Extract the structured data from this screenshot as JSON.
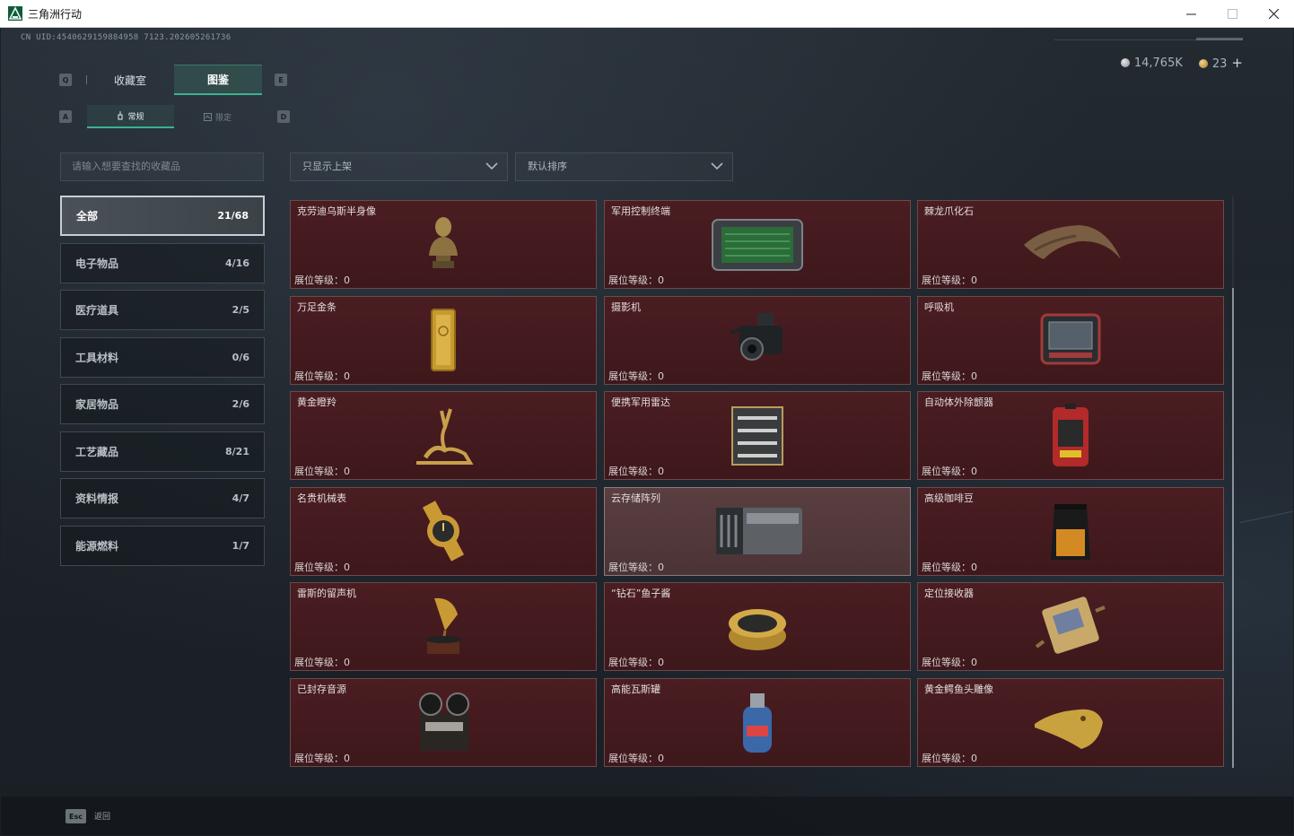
{
  "window": {
    "title": "三角洲行动"
  },
  "uid": "CN UID:4540629159884958 7123.202605261736",
  "currency": {
    "silver": "14,765K",
    "gold": "23",
    "plus": "+"
  },
  "keycaps": {
    "main_left": "Q",
    "main_right": "E",
    "sub_left": "A",
    "sub_right": "D"
  },
  "main_tabs": [
    {
      "label": "收藏室",
      "active": false
    },
    {
      "label": "图鉴",
      "active": true
    }
  ],
  "sub_tabs": [
    {
      "label": "常规",
      "active": true
    },
    {
      "label": "限定",
      "active": false
    }
  ],
  "search": {
    "placeholder": "请输入想要查找的收藏品"
  },
  "filters": {
    "shelf": "只显示上架",
    "sort": "默认排序"
  },
  "categories": [
    {
      "label": "全部",
      "count": "21/68",
      "active": true
    },
    {
      "label": "电子物品",
      "count": "4/16",
      "active": false
    },
    {
      "label": "医疗道具",
      "count": "2/5",
      "active": false
    },
    {
      "label": "工具材料",
      "count": "0/6",
      "active": false
    },
    {
      "label": "家居物品",
      "count": "2/6",
      "active": false
    },
    {
      "label": "工艺藏品",
      "count": "8/21",
      "active": false
    },
    {
      "label": "资料情报",
      "count": "4/7",
      "active": false
    },
    {
      "label": "能源燃料",
      "count": "1/7",
      "active": false
    }
  ],
  "level_label": "展位等级：",
  "items": [
    {
      "name": "克劳迪乌斯半身像",
      "level": "0",
      "icon": "bust-icon"
    },
    {
      "name": "军用控制终端",
      "level": "0",
      "icon": "terminal-icon"
    },
    {
      "name": "棘龙爪化石",
      "level": "0",
      "icon": "claw-fossil-icon"
    },
    {
      "name": "万足金条",
      "level": "0",
      "icon": "gold-bar-icon"
    },
    {
      "name": "摄影机",
      "level": "0",
      "icon": "camera-icon"
    },
    {
      "name": "呼吸机",
      "level": "0",
      "icon": "ventilator-icon"
    },
    {
      "name": "黄金瞪羚",
      "level": "0",
      "icon": "gold-gazelle-icon"
    },
    {
      "name": "便携军用雷达",
      "level": "0",
      "icon": "radar-icon"
    },
    {
      "name": "自动体外除颤器",
      "level": "0",
      "icon": "defibrillator-icon"
    },
    {
      "name": "名贵机械表",
      "level": "0",
      "icon": "watch-icon"
    },
    {
      "name": "云存储阵列",
      "level": "0",
      "icon": "storage-array-icon",
      "selected": true
    },
    {
      "name": "高级咖啡豆",
      "level": "0",
      "icon": "coffee-bag-icon"
    },
    {
      "name": "雷斯的留声机",
      "level": "0",
      "icon": "gramophone-icon"
    },
    {
      "name": "“钻石”鱼子酱",
      "level": "0",
      "icon": "caviar-tin-icon"
    },
    {
      "name": "定位接收器",
      "level": "0",
      "icon": "receiver-icon"
    },
    {
      "name": "已封存音源",
      "level": "0",
      "icon": "reel-recorder-icon"
    },
    {
      "name": "高能瓦斯罐",
      "level": "0",
      "icon": "gas-canister-icon"
    },
    {
      "name": "黄金鳄鱼头雕像",
      "level": "0",
      "icon": "croc-head-icon"
    }
  ],
  "footer": {
    "esc": "Esc",
    "back": "返回"
  }
}
